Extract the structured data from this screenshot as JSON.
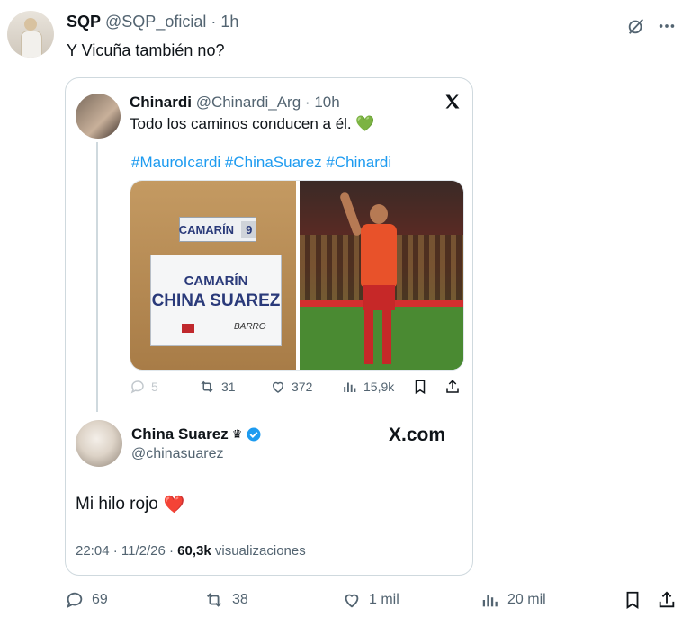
{
  "post": {
    "display_name": "SQP",
    "handle": "@SQP_oficial",
    "separator": "·",
    "time": "1h",
    "text": "Y Vicuña también no?",
    "icons": [
      "grok-icon",
      "more-icon"
    ]
  },
  "quote": {
    "display_name": "Chinardi",
    "handle": "@Chinardi_Arg",
    "separator": "·",
    "time": "10h",
    "text": "Todo los caminos conducen a él.",
    "text_emoji": "💚",
    "hashtags": "#MauroIcardi #ChinaSuarez #Chinardi",
    "images": {
      "left": {
        "sign_small_label": "CAMARÍN",
        "sign_small_number": "9",
        "sign_big_line1": "CAMARÍN",
        "sign_big_line2": "CHINA SUAREZ",
        "sign_big_logo_text": "BARRO"
      }
    },
    "actions": {
      "replies": "5",
      "retweets": "31",
      "likes": "372",
      "views": "15,9k"
    }
  },
  "embed": {
    "display_name": "China Suarez",
    "crown": "♛",
    "handle": "@chinasuarez",
    "brand": "X.com",
    "text": "Mi hilo rojo",
    "text_emoji": "❤️",
    "timestamp": "22:04 · 11/2/26 ·",
    "views_count": "60,3k",
    "views_label": "visualizaciones"
  },
  "actions": {
    "replies": "69",
    "retweets": "38",
    "likes": "1 mil",
    "views": "20 mil"
  },
  "colors": {
    "text": "#0f1419",
    "muted": "#536471",
    "link": "#1d9bf0",
    "border": "#cfd9de",
    "verified": "#1d9bf0",
    "heart": "#e0245e"
  }
}
